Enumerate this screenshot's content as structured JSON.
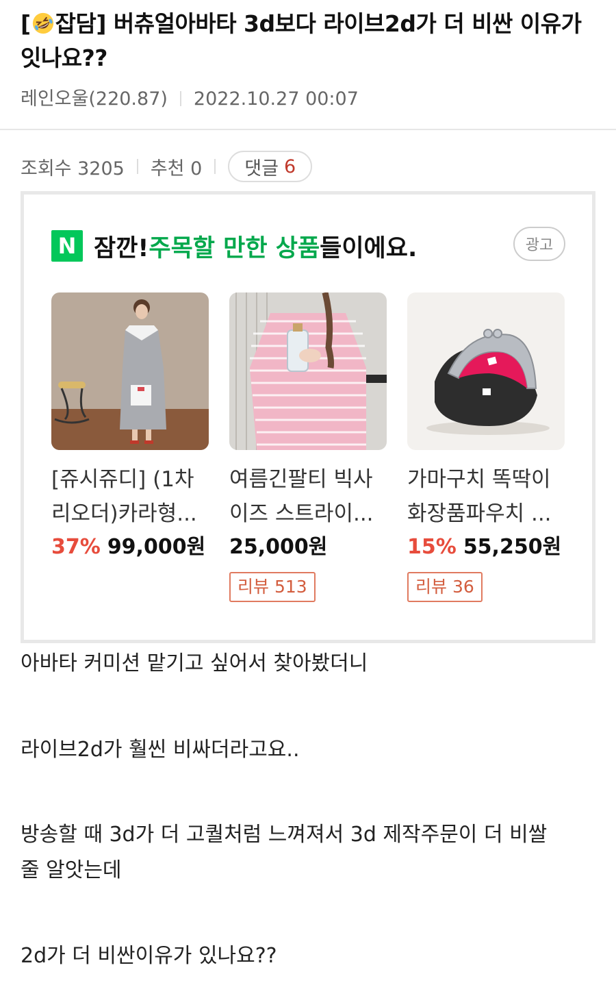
{
  "post": {
    "title_prefix": "[",
    "category": "잡담]",
    "title_rest": " 버츄얼아바타 3d보다 라이브2d가 더 비싼 이유가 잇나요??",
    "author": "레인오울(220.87)",
    "datetime": "2022.10.27 00:07"
  },
  "stats": {
    "views": "조회수 3205",
    "likes": "추천 0",
    "comments_label": "댓글",
    "comments_count": "6"
  },
  "ad": {
    "logo": "N",
    "headline_1": "잠깐! ",
    "headline_highlight": "주목할 만한 상품",
    "headline_2": "들이에요.",
    "badge": "광고",
    "products": [
      {
        "name_line1": "[쥬시쥬디] (1차",
        "name_line2": "리오더)카라형...",
        "discount": "37%",
        "price": "99,000원",
        "review": ""
      },
      {
        "name_line1": "여름긴팔티 빅사",
        "name_line2": "이즈 스트라이...",
        "discount": "",
        "price": "25,000원",
        "review": "리뷰 513"
      },
      {
        "name_line1": "가마구치 똑딱이",
        "name_line2": "화장품파우치 ...",
        "discount": "15%",
        "price": "55,250원",
        "review": "리뷰 36"
      }
    ]
  },
  "content": {
    "p1": "아바타 커미션 맡기고 싶어서 찾아봤더니",
    "p2": "라이브2d가 훨씬 비싸더라고요..",
    "p3_line1": "방송할 때 3d가 더 고퀄처럼 느껴져서 3d 제작주문이 더 비쌀",
    "p3_line2": "줄 알앗는데",
    "p4": "2d가 더 비싼이유가 있나요??"
  }
}
